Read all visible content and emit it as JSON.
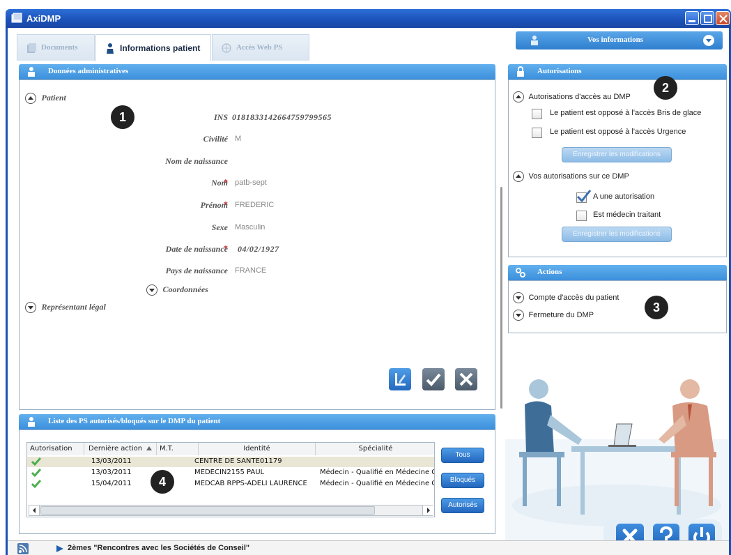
{
  "window": {
    "title": "AxiDMP"
  },
  "tabs": [
    {
      "label": "Documents",
      "active": false
    },
    {
      "label": "Informations patient",
      "active": true
    },
    {
      "label": "Accès Web PS",
      "active": false
    }
  ],
  "user_panel": {
    "label": "Vos informations"
  },
  "admin": {
    "header": "Données administratives",
    "patient_section": "Patient",
    "fields": [
      {
        "label": "INS",
        "value": "0181833142664759799565",
        "required": false
      },
      {
        "label": "Civilité",
        "value": "M",
        "required": false
      },
      {
        "label": "Nom de naissance",
        "value": "",
        "required": false
      },
      {
        "label": "Nom",
        "value": "patb-sept",
        "required": true
      },
      {
        "label": "Prénom",
        "value": "FREDERIC",
        "required": true
      },
      {
        "label": "Sexe",
        "value": "Masculin",
        "required": false
      },
      {
        "label": "Date de naissance",
        "value": "04/02/1927",
        "required": true
      },
      {
        "label": "Pays de naissance",
        "value": "FRANCE",
        "required": false
      }
    ],
    "coordonnees": "Coordonnées",
    "representant": "Représentant légal",
    "required_mark": "*"
  },
  "autorisations": {
    "header": "Autorisations",
    "section1": "Autorisations d'accès au DMP",
    "opt_bris": "Le patient est opposé à l'accès Bris de glace",
    "opt_urgence": "Le patient est opposé à l'accès Urgence",
    "save1": "Enregistrer les modifications",
    "section2": "Vos autorisations sur ce DMP",
    "opt_autorisation": "A une autorisation",
    "opt_traitant": "Est médecin traitant",
    "save2": "Enregistrer les modifications"
  },
  "actions": {
    "header": "Actions",
    "items": [
      "Compte d'accès du patient",
      "Fermeture du DMP"
    ]
  },
  "ps_list": {
    "header": "Liste des PS autorisés/bloqués sur le DMP du patient",
    "columns": [
      "Autorisation",
      "Dernière action",
      "M.T.",
      "Identité",
      "Spécialité"
    ],
    "rows": [
      {
        "date": "13/03/2011",
        "identite": "CENTRE DE SANTE01179",
        "specialite": ""
      },
      {
        "date": "13/03/2011",
        "identite": "MEDECIN2155 PAUL",
        "specialite": "Médecin - Qualifié en Médecine G"
      },
      {
        "date": "15/04/2011",
        "identite": "MEDCAB RPPS-ADELI LAURENCE",
        "specialite": "Médecin - Qualifié en Médecine G"
      }
    ],
    "filters": [
      "Tous",
      "Bloqués",
      "Autorisés"
    ]
  },
  "badges": [
    "1",
    "2",
    "3",
    "4"
  ],
  "status": {
    "message": "2èmes \"Rencontres avec les Sociétés de Conseil\""
  },
  "colors": {
    "accent": "#3b8fdb",
    "title_bar": "#1b51b8",
    "check": "#4caf50"
  }
}
